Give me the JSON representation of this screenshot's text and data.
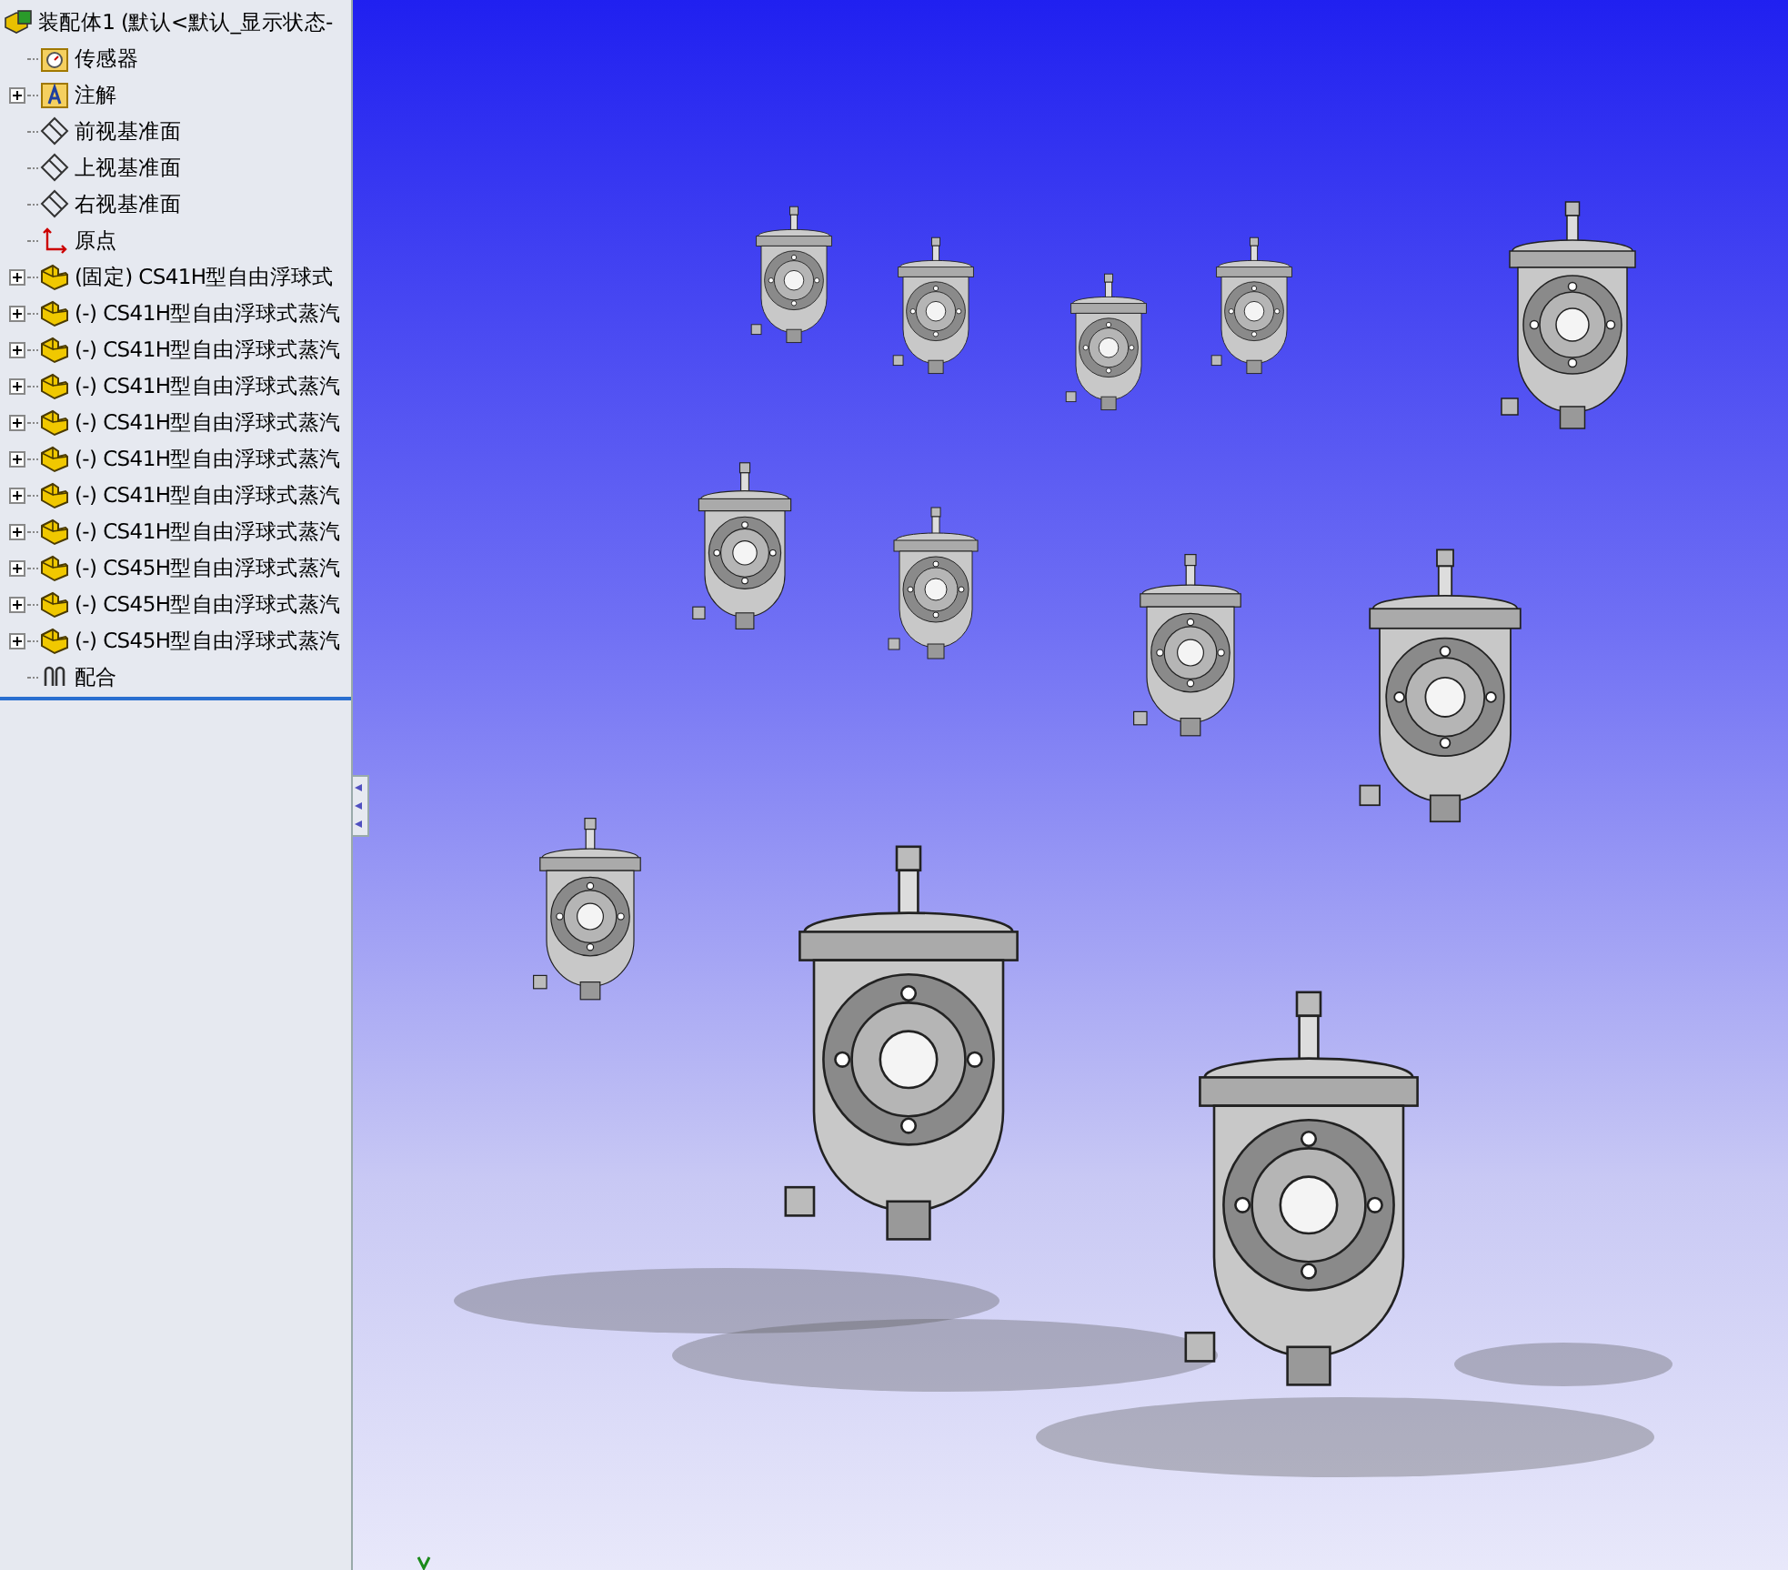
{
  "feature_tree": {
    "root": {
      "label": "装配体1  (默认<默认_显示状态-"
    },
    "items": [
      {
        "kind": "sensor-folder",
        "label": "传感器",
        "expandable": false
      },
      {
        "kind": "annotation-folder",
        "label": "注解",
        "expandable": true
      },
      {
        "kind": "plane",
        "label": "前视基准面",
        "expandable": false
      },
      {
        "kind": "plane",
        "label": "上视基准面",
        "expandable": false
      },
      {
        "kind": "plane",
        "label": "右视基准面",
        "expandable": false
      },
      {
        "kind": "origin",
        "label": "原点",
        "expandable": false
      },
      {
        "kind": "part",
        "label": "(固定) CS41H型自由浮球式",
        "expandable": true
      },
      {
        "kind": "part",
        "label": "(-) CS41H型自由浮球式蒸汽",
        "expandable": true
      },
      {
        "kind": "part",
        "label": "(-) CS41H型自由浮球式蒸汽",
        "expandable": true
      },
      {
        "kind": "part",
        "label": "(-) CS41H型自由浮球式蒸汽",
        "expandable": true
      },
      {
        "kind": "part",
        "label": "(-) CS41H型自由浮球式蒸汽",
        "expandable": true
      },
      {
        "kind": "part",
        "label": "(-) CS41H型自由浮球式蒸汽",
        "expandable": true
      },
      {
        "kind": "part",
        "label": "(-) CS41H型自由浮球式蒸汽",
        "expandable": true
      },
      {
        "kind": "part",
        "label": "(-) CS41H型自由浮球式蒸汽",
        "expandable": true
      },
      {
        "kind": "part",
        "label": "(-) CS45H型自由浮球式蒸汽",
        "expandable": true
      },
      {
        "kind": "part",
        "label": "(-) CS45H型自由浮球式蒸汽",
        "expandable": true
      },
      {
        "kind": "part",
        "label": "(-) CS45H型自由浮球式蒸汽",
        "expandable": true
      },
      {
        "kind": "mates",
        "label": "配合",
        "expandable": false
      }
    ]
  }
}
